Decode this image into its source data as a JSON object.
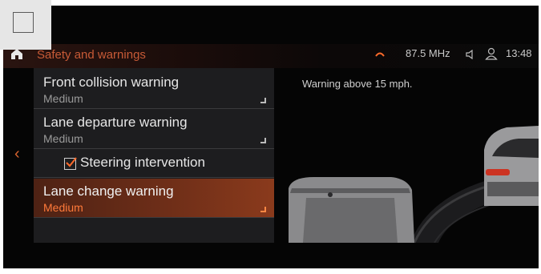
{
  "header": {
    "title": "Safety and warnings",
    "radio": "87.5 MHz",
    "clock": "13:48"
  },
  "menu": {
    "items": [
      {
        "label": "Front collision warning",
        "value": "Medium"
      },
      {
        "label": "Lane departure warning",
        "value": "Medium"
      },
      {
        "label": "Lane change warning",
        "value": "Medium"
      }
    ],
    "checkbox": {
      "label": "Steering intervention",
      "checked": true
    }
  },
  "info": {
    "text": "Warning above 15 mph."
  },
  "colors": {
    "accent": "#d7632f",
    "selected_value": "#ff7a3a",
    "panel": "#1d1d1f"
  },
  "icons": [
    "home-icon",
    "sound-icon",
    "volume-icon",
    "user-icon",
    "chevron-left-icon",
    "window-icon"
  ]
}
